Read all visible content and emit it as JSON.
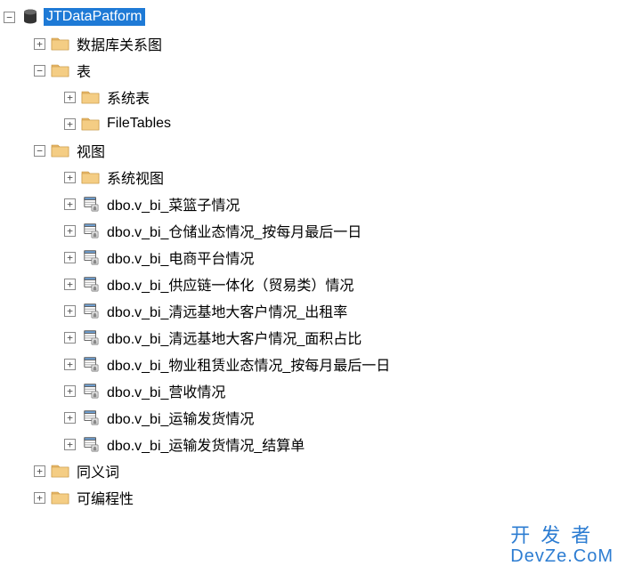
{
  "tree": {
    "root": {
      "label": "JTDataPatform",
      "expanded": true,
      "selected": true,
      "icon": "database",
      "children": [
        {
          "label": "数据库关系图",
          "expanded": false,
          "icon": "folder"
        },
        {
          "label": "表",
          "expanded": true,
          "icon": "folder",
          "children": [
            {
              "label": "系统表",
              "expanded": false,
              "icon": "folder"
            },
            {
              "label": "FileTables",
              "expanded": false,
              "icon": "folder"
            }
          ]
        },
        {
          "label": "视图",
          "expanded": true,
          "icon": "folder",
          "children": [
            {
              "label": "系统视图",
              "expanded": false,
              "icon": "folder"
            },
            {
              "label": "dbo.v_bi_菜篮子情况",
              "expanded": false,
              "icon": "view"
            },
            {
              "label": "dbo.v_bi_仓储业态情况_按每月最后一日",
              "expanded": false,
              "icon": "view"
            },
            {
              "label": "dbo.v_bi_电商平台情况",
              "expanded": false,
              "icon": "view"
            },
            {
              "label": "dbo.v_bi_供应链一体化（贸易类）情况",
              "expanded": false,
              "icon": "view"
            },
            {
              "label": "dbo.v_bi_清远基地大客户情况_出租率",
              "expanded": false,
              "icon": "view"
            },
            {
              "label": "dbo.v_bi_清远基地大客户情况_面积占比",
              "expanded": false,
              "icon": "view"
            },
            {
              "label": "dbo.v_bi_物业租赁业态情况_按每月最后一日",
              "expanded": false,
              "icon": "view"
            },
            {
              "label": "dbo.v_bi_营收情况",
              "expanded": false,
              "icon": "view"
            },
            {
              "label": "dbo.v_bi_运输发货情况",
              "expanded": false,
              "icon": "view"
            },
            {
              "label": "dbo.v_bi_运输发货情况_结算单",
              "expanded": false,
              "icon": "view"
            }
          ]
        },
        {
          "label": "同义词",
          "expanded": false,
          "icon": "folder"
        },
        {
          "label": "可编程性",
          "expanded": false,
          "icon": "folder"
        }
      ]
    }
  },
  "expander": {
    "plus": "+",
    "minus": "−"
  },
  "watermark": {
    "line1": "开发者",
    "line2": "DevZe.CoM"
  }
}
